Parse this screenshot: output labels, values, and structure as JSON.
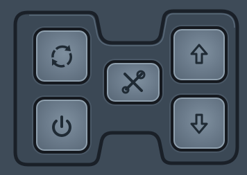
{
  "keypad": {
    "buttons": [
      {
        "id": "refresh",
        "icon": "refresh-icon"
      },
      {
        "id": "power",
        "icon": "power-icon"
      },
      {
        "id": "tools",
        "icon": "tools-icon"
      },
      {
        "id": "up",
        "icon": "arrow-up-icon"
      },
      {
        "id": "down",
        "icon": "arrow-down-icon"
      }
    ],
    "colors": {
      "panel": "#3e4b58",
      "button": "#6c7c8c",
      "outline": "#15191f",
      "symbol": "#1f2a34"
    }
  }
}
